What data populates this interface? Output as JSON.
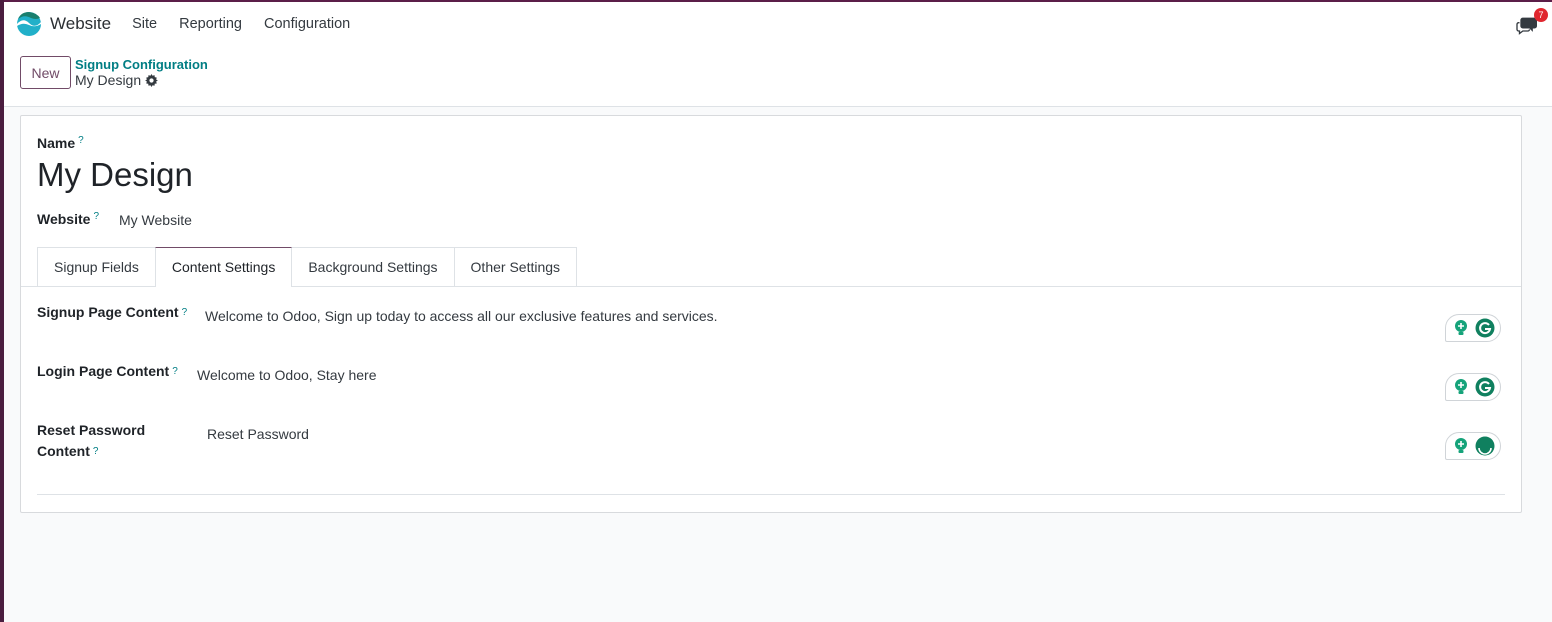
{
  "navbar": {
    "app_name": "Website",
    "menu": [
      "Site",
      "Reporting",
      "Configuration"
    ],
    "chat_badge": "7"
  },
  "control_panel": {
    "new_label": "New",
    "breadcrumb": "Signup Configuration",
    "record_title": "My Design"
  },
  "form": {
    "name_label": "Name",
    "name_value": "My Design",
    "website_label": "Website",
    "website_value": "My Website",
    "tooltip_mark": "?",
    "tabs": [
      "Signup Fields",
      "Content Settings",
      "Background Settings",
      "Other Settings"
    ],
    "active_tab": "Content Settings",
    "fields": [
      {
        "label": "Signup Page Content",
        "value": "Welcome to Odoo,  Sign up today to access all our exclusive features and services."
      },
      {
        "label": "Login Page Content",
        "value": "Welcome to Odoo, Stay here"
      },
      {
        "label_line1": "Reset Password",
        "label_line2": "Content",
        "value": "Reset Password"
      }
    ]
  },
  "colors": {
    "brand": "#714b67",
    "link": "#017e84",
    "badge": "#e0272f",
    "grammarly": "#15a37a"
  }
}
